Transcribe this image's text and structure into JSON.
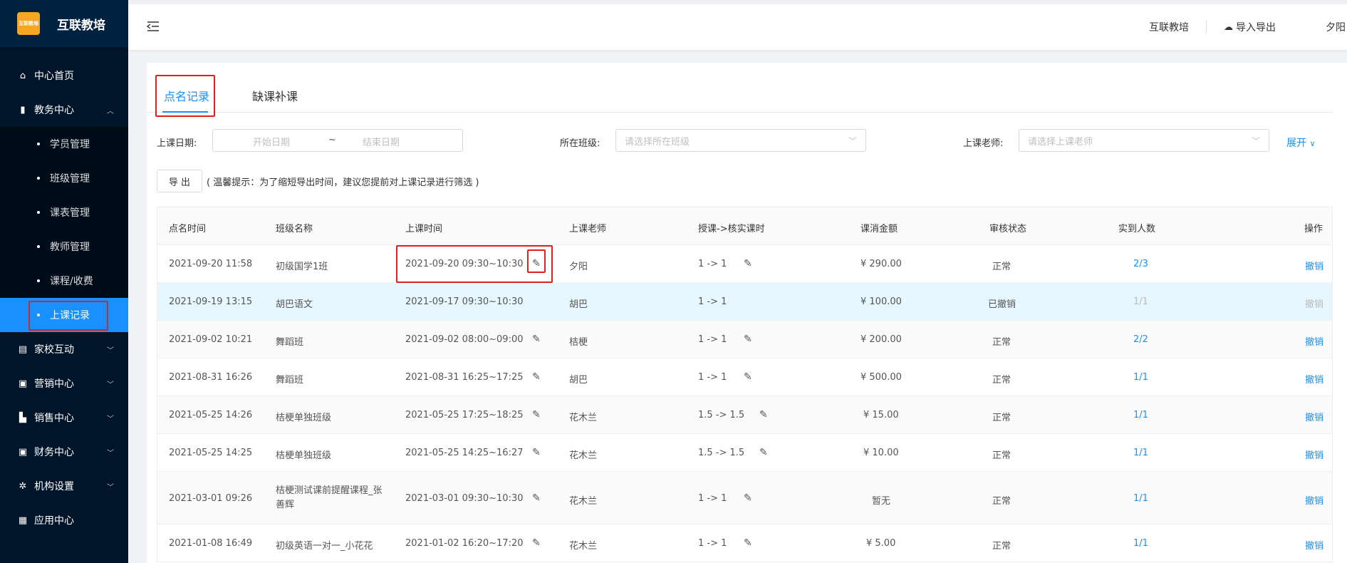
{
  "sidebar": {
    "logo_badge": "互联教培",
    "app_name": "互联教培",
    "items": [
      {
        "label": "中心首页",
        "icon": "home-icon"
      },
      {
        "label": "教务中心",
        "icon": "book-icon"
      },
      {
        "label": "家校互动",
        "icon": "chat-icon"
      },
      {
        "label": "营销中心",
        "icon": "bag-icon"
      },
      {
        "label": "销售中心",
        "icon": "chart-icon"
      },
      {
        "label": "财务中心",
        "icon": "wallet-icon"
      },
      {
        "label": "机构设置",
        "icon": "gear-icon"
      },
      {
        "label": "应用中心",
        "icon": "grid-icon"
      }
    ],
    "sub_items": [
      "学员管理",
      "班级管理",
      "课表管理",
      "教师管理",
      "课程/收费",
      "上课记录"
    ],
    "active_sub": "上课记录"
  },
  "header": {
    "org": "互联教培",
    "import_export": "导入导出",
    "user": "夕阳"
  },
  "tabs": [
    "点名记录",
    "缺课补课"
  ],
  "filters": {
    "date_label": "上课日期:",
    "start_placeholder": "开始日期",
    "tilde": "~",
    "end_placeholder": "结束日期",
    "class_label": "所在班级:",
    "class_placeholder": "请选择所在班级",
    "teacher_label": "上课老师:",
    "teacher_placeholder": "请选择上课老师",
    "expand": "展开"
  },
  "export": {
    "button": "导 出",
    "tip": "( 温馨提示：为了缩短导出时间，建议您提前对上课记录进行筛选 )"
  },
  "table": {
    "columns": [
      "点名时间",
      "班级名称",
      "上课时间",
      "上课老师",
      "授课->核实课时",
      "课消金额",
      "审核状态",
      "实到人数",
      "操作"
    ],
    "rows": [
      {
        "roll": "2021-09-20 11:58",
        "cls": "初级国学1班",
        "time": "2021-09-20 09:30~10:30",
        "teacher": "夕阳",
        "hours": "1 -> 1",
        "amount": "¥ 290.00",
        "status": "正常",
        "count": "2/3",
        "op": "撤销",
        "revoked": false
      },
      {
        "roll": "2021-09-19 13:15",
        "cls": "胡巴语文",
        "time": "2021-09-17 09:30~10:30",
        "teacher": "胡巴",
        "hours": "1 -> 1",
        "amount": "¥ 100.00",
        "status": "已撤销",
        "count": "1/1",
        "op": "撤销",
        "revoked": true
      },
      {
        "roll": "2021-09-02 10:21",
        "cls": "舞蹈班",
        "time": "2021-09-02 08:00~09:00",
        "teacher": "桔梗",
        "hours": "1 -> 1",
        "amount": "¥ 200.00",
        "status": "正常",
        "count": "2/2",
        "op": "撤销",
        "revoked": false
      },
      {
        "roll": "2021-08-31 16:26",
        "cls": "舞蹈班",
        "time": "2021-08-31 16:25~17:25",
        "teacher": "胡巴",
        "hours": "1 -> 1",
        "amount": "¥ 500.00",
        "status": "正常",
        "count": "1/1",
        "op": "撤销",
        "revoked": false
      },
      {
        "roll": "2021-05-25 14:26",
        "cls": "桔梗单独班级",
        "time": "2021-05-25 17:25~18:25",
        "teacher": "花木兰",
        "hours": "1.5 -> 1.5",
        "amount": "¥ 15.00",
        "status": "正常",
        "count": "1/1",
        "op": "撤销",
        "revoked": false
      },
      {
        "roll": "2021-05-25 14:25",
        "cls": "桔梗单独班级",
        "time": "2021-05-25 14:25~16:27",
        "teacher": "花木兰",
        "hours": "1.5 -> 1.5",
        "amount": "¥ 10.00",
        "status": "正常",
        "count": "1/1",
        "op": "撤销",
        "revoked": false
      },
      {
        "roll": "2021-03-01 09:26",
        "cls": "桔梗测试课前提醒课程_张善辉",
        "time": "2021-03-01 09:30~10:30",
        "teacher": "花木兰",
        "hours": "1 -> 1",
        "amount": "暂无",
        "status": "正常",
        "count": "1/1",
        "op": "撤销",
        "revoked": false
      },
      {
        "roll": "2021-01-08 16:49",
        "cls": "初级英语一对一_小花花",
        "time": "2021-01-02 16:20~17:20",
        "teacher": "花木兰",
        "hours": "1 -> 1",
        "amount": "¥ 5.00",
        "status": "正常",
        "count": "1/1",
        "op": "撤销",
        "revoked": false
      }
    ]
  },
  "colors": {
    "sidebar_bg": "#001529",
    "accent": "#1890ff",
    "highlight_box": "#e0201b"
  }
}
